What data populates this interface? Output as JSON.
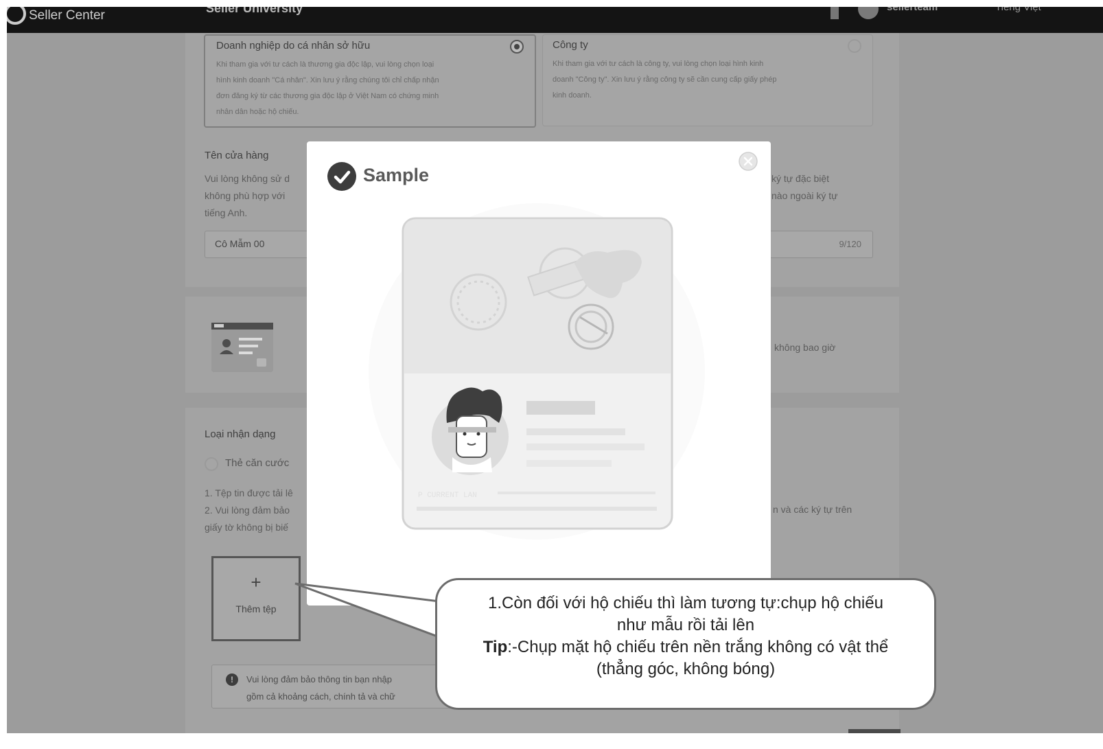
{
  "header": {
    "brand": "Seller Center",
    "section": "Seller University",
    "user": "sellerteam",
    "language": "Tiếng Việt"
  },
  "business_type": {
    "individual": {
      "title": "Doanh nghiệp do cá nhân sở hữu",
      "desc_lines": [
        "Khi tham gia với tư cách là thương gia độc lập, vui lòng chọn loại",
        "hình kinh doanh \"Cá nhân\". Xin lưu ý rằng chúng tôi chỉ chấp nhận",
        "đơn đăng ký từ các thương gia độc lập ở Việt Nam có chứng minh",
        "nhân dân hoặc hộ chiếu."
      ]
    },
    "company": {
      "title": "Công ty",
      "desc_lines": [
        "Khi tham gia với tư cách là công ty, vui lòng chọn loại hình kinh",
        "doanh \"Công ty\". Xin lưu ý rằng công ty sẽ cần cung cấp giấy phép",
        "kinh doanh."
      ]
    }
  },
  "store": {
    "label": "Tên cửa hàng",
    "help_left": [
      "Vui lòng không sử d",
      "không phù hợp với",
      "tiếng Anh."
    ],
    "help_right": [
      "ký tự đặc biệt",
      "nào ngoài ký tự"
    ],
    "value": "Cô Mẫm 00",
    "count": "9/120"
  },
  "id_section": {
    "note_right": "không bao giờ"
  },
  "id_type": {
    "label": "Loại nhận dạng",
    "option": "Thẻ căn cước",
    "rules_left": [
      "1. Tệp tin được tải lê",
      "2. Vui lòng đảm bảo",
      "giấy tờ không bị biế"
    ],
    "rules_right": "n và các ký tự trên",
    "upload_label": "Thêm tệp",
    "notice_lines": [
      "Vui lòng đảm bảo thông tin bạn nhập",
      "gồm cả khoảng cách, chính tả và chữ"
    ]
  },
  "modal": {
    "title": "Sample",
    "passport_label": "P CURRENT LAN"
  },
  "callout": {
    "line1": "1.Còn đối với hộ chiếu thì làm tương tự:chụp hộ chiếu",
    "line2": "như mẫu rồi tải lên",
    "tip_label": "Tip",
    "tip_text": ":-Chụp mặt hộ chiếu trên nền trắng không có vật thể",
    "line4": "(thẳng góc, không bóng)"
  }
}
